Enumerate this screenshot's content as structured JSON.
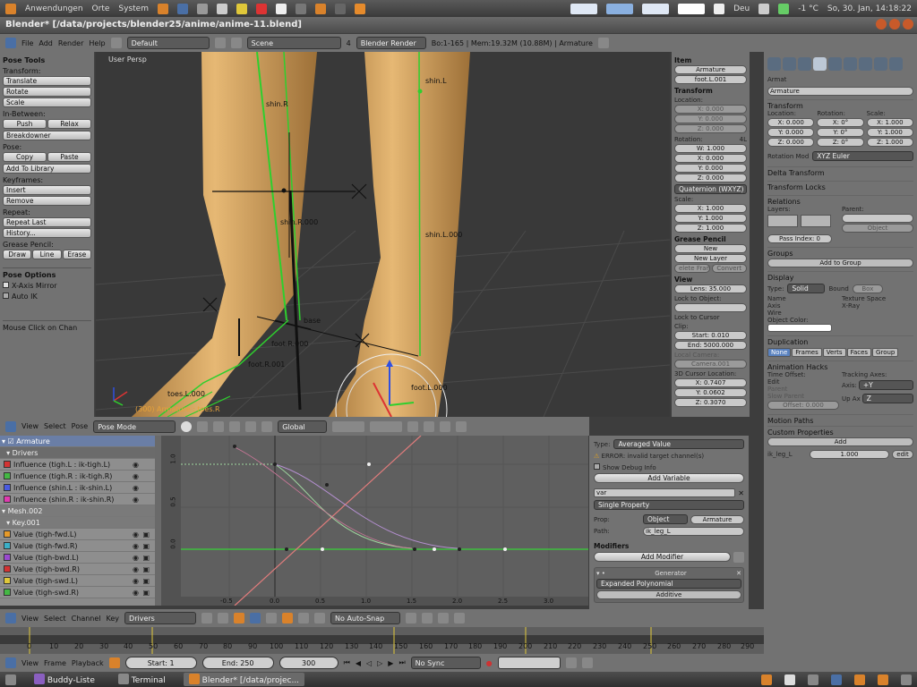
{
  "system_bar": {
    "menus": [
      "Anwendungen",
      "Orte",
      "System"
    ],
    "keyboard_layout": "Deu",
    "weather": "-1 °C",
    "clock": "So, 30. Jan, 14:18:22"
  },
  "window": {
    "title": "Blender* [/data/projects/blender25/anime/anime-11.blend]"
  },
  "menu": {
    "items": [
      "File",
      "Add",
      "Render",
      "Help"
    ],
    "layout": "Default",
    "scene": "Scene",
    "scene_users": "4",
    "engine": "Blender Render",
    "stats": "Bo:1-165 | Mem:19.32M (10.88M) | Armature"
  },
  "tool_panel": {
    "title": "Pose Tools",
    "transform_label": "Transform:",
    "translate": "Translate",
    "rotate": "Rotate",
    "scale": "Scale",
    "inbetween_label": "In-Between:",
    "push": "Push",
    "relax": "Relax",
    "breakdowner": "Breakdowner",
    "pose_label": "Pose:",
    "copy": "Copy",
    "paste": "Paste",
    "add_library": "Add To Library",
    "keyframes_label": "Keyframes:",
    "insert": "Insert",
    "remove": "Remove",
    "repeat_label": "Repeat:",
    "repeat_last": "Repeat Last",
    "history": "History...",
    "grease_label": "Grease Pencil:",
    "draw": "Draw",
    "line": "Line",
    "erase": "Erase",
    "pose_options": "Pose Options",
    "xaxis_mirror": "X-Axis Mirror",
    "auto_ik": "Auto IK",
    "mouse_click": "Mouse Click on Chan"
  },
  "viewport": {
    "label": "User Persp",
    "bone_labels": [
      "shin.R",
      "shin.L",
      "shin.R.000",
      "shin.L.000",
      "base",
      "foot.R.000",
      "foot.R.001",
      "foot.L.000",
      "toes.L.000"
    ],
    "frame_info": "(300) Armature : toes.R"
  },
  "viewport_header": {
    "menus": [
      "View",
      "Select",
      "Pose"
    ],
    "mode": "Pose Mode",
    "orientation": "Global"
  },
  "n_panel": {
    "item_label": "Item",
    "item_name": "Armature",
    "bone_name": "foot.L.001",
    "transform_label": "Transform",
    "location_label": "Location:",
    "loc": [
      "X: 0.000",
      "Y: 0.000",
      "Z: 0.000"
    ],
    "rotation_label": "Rotation:",
    "rotation_lock": "4L",
    "rot": [
      "W: 1.000",
      "X: 0.000",
      "Y: 0.000",
      "Z: 0.000"
    ],
    "rot_mode": "Quaternion (WXYZ)",
    "scale_label": "Scale:",
    "scale": [
      "X: 1.000",
      "Y: 1.000",
      "Z: 1.000"
    ],
    "grease_label": "Grease Pencil",
    "gp_new": "New",
    "gp_new_layer": "New Layer",
    "gp_delete": "elete Fram",
    "gp_convert": "Convert",
    "view_label": "View",
    "lens": "Lens: 35.000",
    "lock_object_label": "Lock to Object:",
    "lock_cursor": "Lock to Cursor",
    "clip_label": "Clip:",
    "clip_start": "Start: 0.010",
    "clip_end": "End: 5000.000",
    "local_camera_label": "Local Camera:",
    "local_camera": "Camera.001",
    "cursor_label": "3D Cursor Location:",
    "cursor": [
      "X: 0.7407",
      "Y: 0.0602",
      "Z: 0.3070"
    ]
  },
  "properties": {
    "object_short": "Armat",
    "object_name": "Armature",
    "transform_label": "Transform",
    "location_label": "Location:",
    "rotation_label": "Rotation:",
    "scale_label": "Scale:",
    "loc": [
      "X: 0.000",
      "Y: 0.000",
      "Z: 0.000"
    ],
    "rot": [
      "X: 0°",
      "Y: 0°",
      "Z: 0°"
    ],
    "scale": [
      "X: 1.000",
      "Y: 1.000",
      "Z: 1.000"
    ],
    "rotation_mode_label": "Rotation Mod",
    "rotation_mode": "XYZ Euler",
    "delta": "Delta Transform",
    "locks": "Transform Locks",
    "relations": "Relations",
    "layers_label": "Layers:",
    "parent_label": "Parent:",
    "parent_type": "Object",
    "pass_index": "Pass Index: 0",
    "groups": "Groups",
    "add_group": "Add to Group",
    "display": "Display",
    "type_label": "Type:",
    "type_value": "Solid",
    "bound": "Bound",
    "bound_type": "Box",
    "name": "Name",
    "texture_space": "Texture Space",
    "axis": "Axis",
    "xray": "X-Ray",
    "wire": "Wire",
    "object_color_label": "Object Color:",
    "duplication": "Duplication",
    "dup_tabs": [
      "None",
      "Frames",
      "Verts",
      "Faces",
      "Group"
    ],
    "anim_hacks": "Animation Hacks",
    "time_offset_label": "Time Offset:",
    "tracking_label": "Tracking Axes:",
    "edit": "Edit",
    "axis_label": "Axis:",
    "axis_value": "+Y",
    "parent_chk": "Parent",
    "up_label": "Up Ax",
    "up_value": "Z",
    "slow_parent": "Slow Parent",
    "offset": "Offset: 0.000",
    "motion_paths": "Motion Paths",
    "custom_props": "Custom Properties",
    "add": "Add",
    "prop_name": "ik_leg_L",
    "prop_value": "1.000",
    "prop_edit": "edit"
  },
  "channels": {
    "summary": "Armature",
    "drivers_label": "Drivers",
    "drivers": [
      {
        "label": "Influence (tigh.L : ik-tigh.L)",
        "color": "#d33333"
      },
      {
        "label": "Influence (tigh.R : ik-tigh.R)",
        "color": "#44b844"
      },
      {
        "label": "Influence (shin.L : ik-shin.L)",
        "color": "#4a5be0"
      },
      {
        "label": "Influence (shin.R : ik-shin.R)",
        "color": "#e03ab0"
      }
    ],
    "mesh_label": "Mesh.002",
    "key_label": "Key.001",
    "keys": [
      {
        "label": "Value (tigh-fwd.L)",
        "color": "#e59a2a"
      },
      {
        "label": "Value (tigh-fwd.R)",
        "color": "#3ab0c8"
      },
      {
        "label": "Value (tigh-bwd.L)",
        "color": "#9a4ad0"
      },
      {
        "label": "Value (tigh-bwd.R)",
        "color": "#d33333"
      },
      {
        "label": "Value (tigh-swd.L)",
        "color": "#e0c83a"
      },
      {
        "label": "Value (tigh-swd.R)",
        "color": "#44b844"
      }
    ]
  },
  "graph": {
    "y_ticks": [
      "1.0",
      "0.5",
      "0.0"
    ],
    "x_ticks": [
      "-0.5",
      "0.0",
      "0.5",
      "1.0",
      "1.5",
      "2.0",
      "2.5",
      "3.0"
    ]
  },
  "driver_panel": {
    "type_label": "Type:",
    "type_value": "Averaged Value",
    "error": "ERROR: invalid target channel(s)",
    "show_debug": "Show Debug Info",
    "add_variable": "Add Variable",
    "var_name": "var",
    "var_type": "Single Property",
    "prop_label": "Prop:",
    "prop_type": "Object",
    "prop_object": "Armature",
    "path_label": "Path:",
    "path": "ik_leg_L",
    "modifiers_label": "Modifiers",
    "add_modifier": "Add Modifier",
    "generator": "Generator",
    "poly_mode": "Expanded Polynomial",
    "additive": "Additive"
  },
  "graph_header": {
    "menus": [
      "View",
      "Select",
      "Channel",
      "Key"
    ],
    "mode": "Drivers",
    "snap": "No Auto-Snap"
  },
  "timeline": {
    "ticks": [
      "0",
      "10",
      "20",
      "30",
      "40",
      "50",
      "60",
      "70",
      "80",
      "90",
      "100",
      "110",
      "120",
      "130",
      "140",
      "150",
      "160",
      "170",
      "180",
      "190",
      "200",
      "210",
      "220",
      "230",
      "240",
      "250",
      "260",
      "270",
      "280",
      "290"
    ]
  },
  "timeline_header": {
    "menus": [
      "View",
      "Frame",
      "Playback"
    ],
    "start": "Start: 1",
    "end": "End: 250",
    "current": "300",
    "sync": "No Sync"
  },
  "taskbar": {
    "items": [
      "Buddy-Liste",
      "Terminal",
      "Blender* [/data/projec..."
    ]
  }
}
